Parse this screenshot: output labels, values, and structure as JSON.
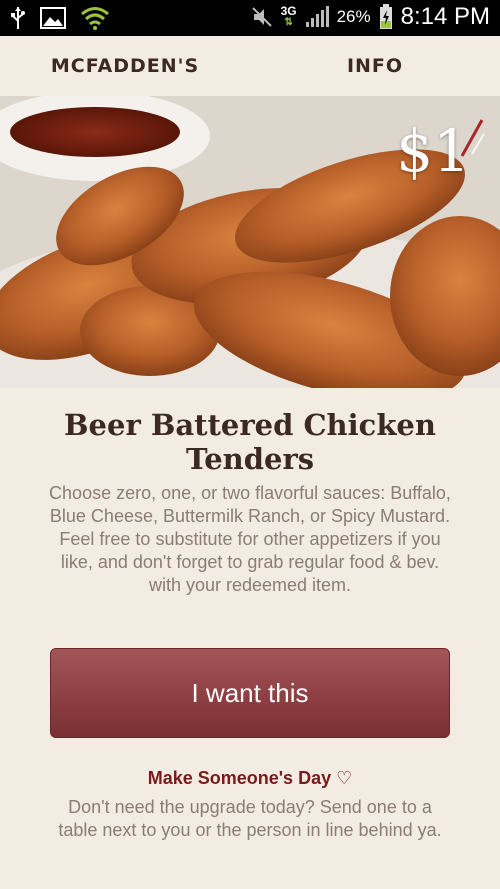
{
  "status_bar": {
    "network": "3G",
    "battery": "26%",
    "time": "8:14 PM"
  },
  "tabs": [
    {
      "label": "MCFADDEN'S",
      "active": true
    },
    {
      "label": "INFO",
      "active": false
    }
  ],
  "hero": {
    "price": "$1",
    "image": "chicken-tenders-photo"
  },
  "offer": {
    "title": "Beer Battered Chicken Tenders",
    "description": "Choose zero, one, or two flavorful sauces: Buffalo, Blue Cheese, Buttermilk Ranch, or Spicy Mustard.  Feel free to substitute for other appetizers if you like, and don't forget to grab regular food & bev. with your redeemed item.",
    "cta_label": "I want this"
  },
  "gift": {
    "title": "Make Someone's Day",
    "icon": "heart-icon",
    "description": "Don't need the upgrade today? Send one to a table next to you or the person in line behind ya."
  },
  "colors": {
    "accent": "#7a1a1c",
    "button": "#8e3f43",
    "background": "#f3ece2",
    "text_dark": "#3b2a22",
    "text_muted": "#8a7d72"
  }
}
